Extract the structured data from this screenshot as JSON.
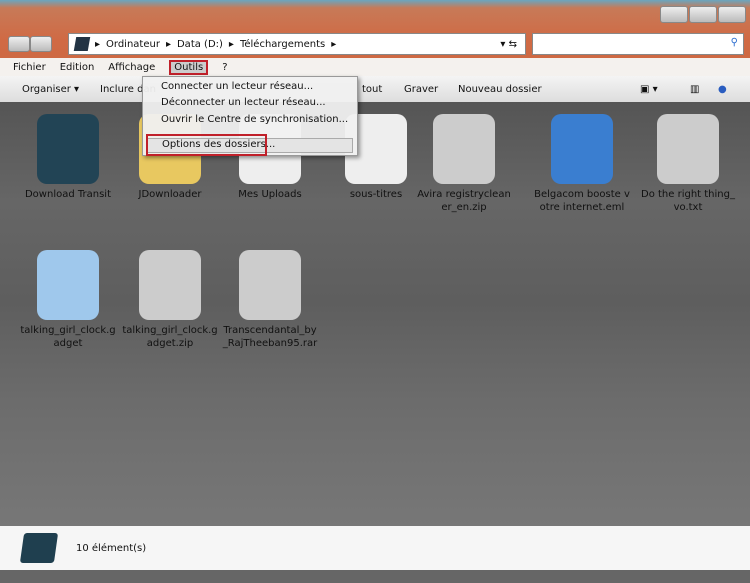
{
  "address": {
    "crumbs": [
      "Ordinateur",
      "Data (D:)",
      "Téléchargements"
    ]
  },
  "menubar": [
    "Fichier",
    "Edition",
    "Affichage",
    "Outils",
    "?"
  ],
  "toolbar": {
    "organiser": "Organiser ▾",
    "include": "Inclure dan",
    "tout": "tout",
    "graver": "Graver",
    "new_folder": "Nouveau dossier"
  },
  "tools_menu": [
    "Connecter un lecteur réseau...",
    "Déconnecter un lecteur réseau...",
    "Ouvrir le Centre de synchronisation...",
    "Options des dossiers..."
  ],
  "items": [
    {
      "name": "Download Transit",
      "icon": "app-icon",
      "color": "#224455"
    },
    {
      "name": "JDownloader",
      "icon": "folder-icon",
      "color": "#e8c860"
    },
    {
      "name": "Mes Uploads",
      "icon": "folder-docs-icon",
      "color": "#eeeeee"
    },
    {
      "name": "sous-titres",
      "icon": "folder-firefox-icon",
      "color": "#eeeeee"
    },
    {
      "name": "Avira registrycleaner_en.zip",
      "icon": "zip-icon",
      "color": "#cccccc"
    },
    {
      "name": "Belgacom booste votre internet.eml",
      "icon": "thunderbird-icon",
      "color": "#3a7ed0"
    },
    {
      "name": "Do the right thing_vo.txt",
      "icon": "text-file-icon",
      "color": "#cccccc"
    },
    {
      "name": "talking_girl_clock.gadget",
      "icon": "gadget-icon",
      "color": "#9fc8ec"
    },
    {
      "name": "talking_girl_clock.gadget.zip",
      "icon": "zip-icon",
      "color": "#cccccc"
    },
    {
      "name": "Transcendantal_by_RajTheeban95.rar",
      "icon": "rar-icon",
      "color": "#cccccc"
    }
  ],
  "status": {
    "count": "10 élément(s)"
  }
}
